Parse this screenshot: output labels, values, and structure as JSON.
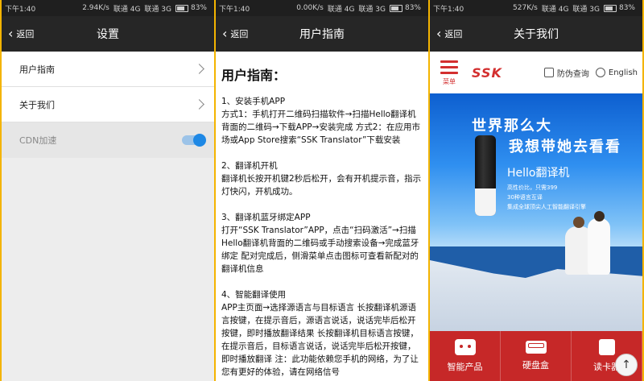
{
  "panel1": {
    "status": {
      "time": "下午1:40",
      "speed": "2.94K/s",
      "carrier1": "联通 4G",
      "carrier2": "联通 3G",
      "battery": "83%"
    },
    "nav": {
      "back": "返回",
      "title": "设置"
    },
    "rows": [
      {
        "label": "用户指南"
      },
      {
        "label": "关于我们"
      }
    ],
    "cdn": {
      "label": "CDN加速",
      "enabled": true
    }
  },
  "panel2": {
    "status": {
      "time": "下午1:40",
      "speed": "0.00K/s",
      "carrier1": "联通 4G",
      "carrier2": "联通 3G",
      "battery": "83%"
    },
    "nav": {
      "back": "返回",
      "title": "用户指南"
    },
    "heading": "用户指南：",
    "sections": [
      {
        "title": "1、安装手机APP",
        "body": "方式1：手机打开二维码扫描软件→扫描Hello翻译机背面的二维码→下载APP→安装完成 方式2：在应用市场或App Store搜索“SSK Translator”下载安装"
      },
      {
        "title": "2、翻译机开机",
        "body": "翻译机长按开机键2秒后松开，会有开机提示音，指示灯快闪，开机成功。"
      },
      {
        "title": "3、翻译机蓝牙绑定APP",
        "body": "打开“SSK Translator”APP，点击“扫码激活”→扫描Hello翻译机背面的二维码或手动搜索设备→完成蓝牙绑定 配对完成后，侧滑菜单点击图标可查看新配对的翻译机信息"
      },
      {
        "title": "4、智能翻译使用",
        "body": "APP主页面→选择源语言与目标语言 长按翻译机源语言按键，在提示音后，源语言说话，说话完毕后松开按键，即时播放翻译结果 长按翻译机目标语言按键，在提示音后，目标语言说话，说话完毕后松开按键，即时播放翻译 注：此功能依赖您手机的网络，为了让您有更好的体验，请在网络信号"
      }
    ]
  },
  "panel3": {
    "status": {
      "time": "下午1:40",
      "speed": "527K/s",
      "carrier1": "联通 4G",
      "carrier2": "联通 3G",
      "battery": "83%"
    },
    "nav": {
      "back": "返回",
      "title": "关于我们"
    },
    "header": {
      "menu_label": "菜单",
      "logo": "SSK",
      "query": "防伪查询",
      "language": "English"
    },
    "banner": {
      "slogan1": "世界那么大",
      "slogan2": "我想带她去看看",
      "product": "Hello翻译机",
      "features": [
        "高性价比，只需399",
        "30种语言互译",
        "集成全球顶尖人工智能翻译引擎"
      ]
    },
    "bottom": [
      {
        "label": "智能产品"
      },
      {
        "label": "硬盘盒"
      },
      {
        "label": "读卡器"
      }
    ],
    "totop": "↑"
  }
}
